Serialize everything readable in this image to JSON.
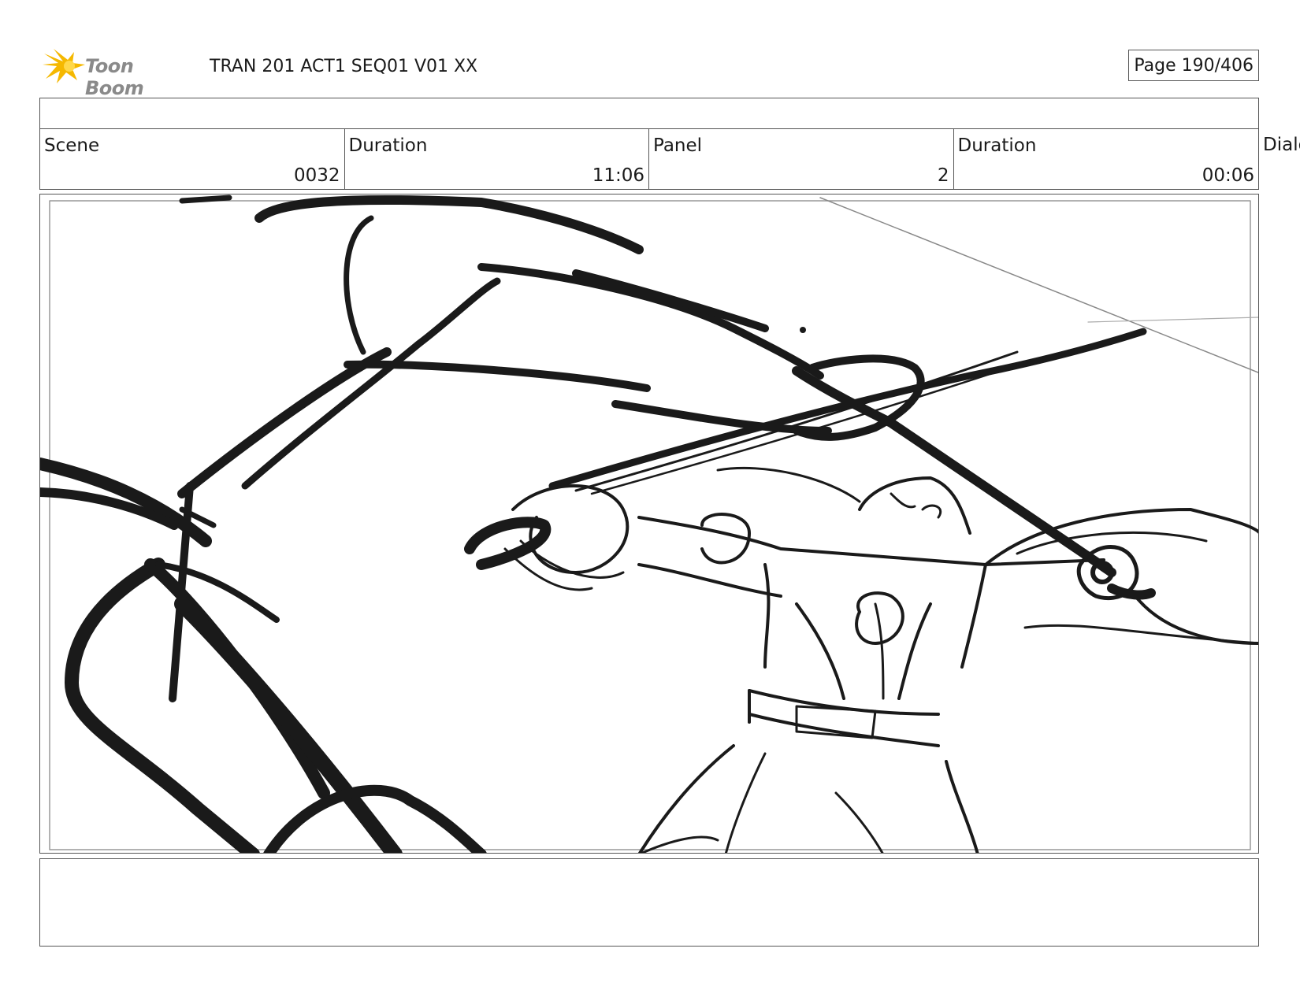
{
  "header": {
    "logo_text": "Toon Boom",
    "document_title": "TRAN 201 ACT1 SEQ01 V01 XX",
    "page_indicator": "Page 190/406"
  },
  "info": {
    "scene_label": "Scene",
    "scene_value": "0032",
    "scene_duration_label": "Duration",
    "scene_duration_value": "11:06",
    "panel_label": "Panel",
    "panel_value": "2",
    "panel_duration_label": "Duration",
    "panel_duration_value": "00:06",
    "dialogue_label": "Dialo"
  },
  "colors": {
    "sketch": "#1a1a1a",
    "logo_star": "#f5b800",
    "logo_text": "#8a8a8a",
    "border": "#555555"
  }
}
